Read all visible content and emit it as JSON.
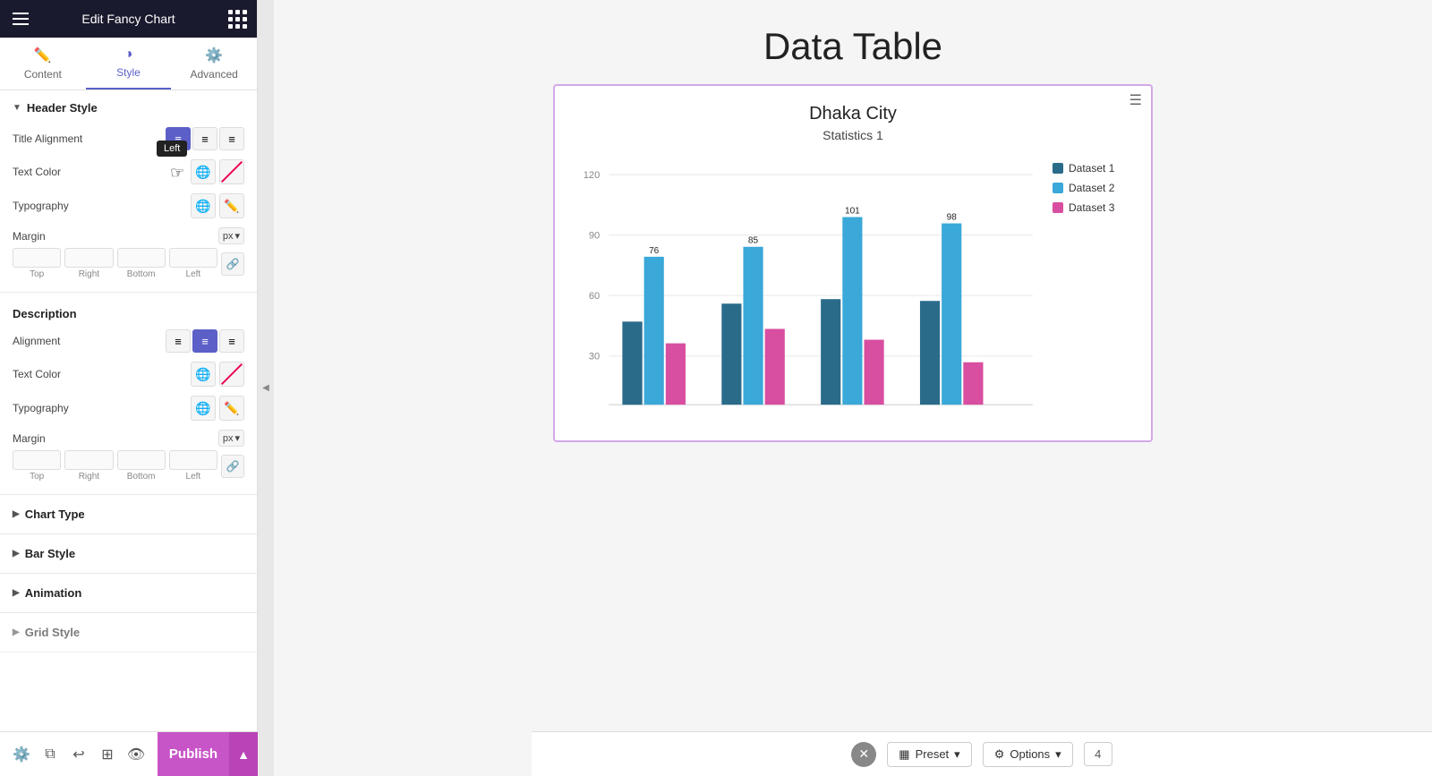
{
  "panel": {
    "title": "Edit Fancy Chart",
    "tabs": [
      {
        "id": "content",
        "label": "Content",
        "icon": "✏️"
      },
      {
        "id": "style",
        "label": "Style",
        "icon": "◑"
      },
      {
        "id": "advanced",
        "label": "Advanced",
        "icon": "⚙️"
      }
    ],
    "active_tab": "style",
    "sections": {
      "header_style": {
        "label": "Header Style",
        "title_alignment": {
          "label": "Title Alignment",
          "options": [
            "left",
            "center",
            "right"
          ],
          "active": "left"
        },
        "text_color": {
          "label": "Text Color"
        },
        "typography": {
          "label": "Typography"
        },
        "margin": {
          "label": "Margin",
          "unit": "px",
          "top": "",
          "right": "",
          "bottom": "",
          "left": "",
          "labels": [
            "Top",
            "Right",
            "Bottom",
            "Left"
          ]
        }
      },
      "description": {
        "label": "Description",
        "alignment": {
          "label": "Alignment",
          "options": [
            "left",
            "center",
            "right"
          ],
          "active": "center"
        },
        "text_color": {
          "label": "Text Color"
        },
        "typography": {
          "label": "Typography"
        },
        "margin": {
          "label": "Margin",
          "unit": "px",
          "top": "",
          "right": "",
          "bottom": "",
          "left": "",
          "labels": [
            "Top",
            "Right",
            "Bottom",
            "Left"
          ]
        }
      },
      "chart_type": {
        "label": "Chart Type"
      },
      "bar_style": {
        "label": "Bar Style"
      },
      "animation": {
        "label": "Animation"
      },
      "grid_style": {
        "label": "Grid Style"
      }
    }
  },
  "tooltip": {
    "text": "Left"
  },
  "bottom_bar": {
    "publish_label": "Publish"
  },
  "main": {
    "page_title": "Data Table",
    "chart": {
      "title": "Dhaka City",
      "subtitle": "Statistics 1",
      "legend": [
        {
          "label": "Dataset 1",
          "color": "#2a6b8a"
        },
        {
          "label": "Dataset 2",
          "color": "#3aa8d8"
        },
        {
          "label": "Dataset 3",
          "color": "#d84ea0"
        }
      ],
      "y_labels": [
        "120",
        "90",
        "60",
        "30"
      ],
      "groups": [
        {
          "bars": [
            {
              "value": 44,
              "color": "#2a6b8a",
              "height_pct": 37
            },
            {
              "value": 76,
              "color": "#3aa8d8",
              "height_pct": 63
            },
            {
              "value": 35,
              "color": "#d84ea0",
              "height_pct": 29
            }
          ]
        },
        {
          "bars": [
            {
              "value": 55,
              "color": "#2a6b8a",
              "height_pct": 46
            },
            {
              "value": 85,
              "color": "#3aa8d8",
              "height_pct": 71
            },
            {
              "value": 41,
              "color": "#d84ea0",
              "height_pct": 34
            }
          ]
        },
        {
          "bars": [
            {
              "value": 57,
              "color": "#2a6b8a",
              "height_pct": 48
            },
            {
              "value": 101,
              "color": "#3aa8d8",
              "height_pct": 84
            },
            {
              "value": 36,
              "color": "#d84ea0",
              "height_pct": 30
            }
          ]
        },
        {
          "bars": [
            {
              "value": 56,
              "color": "#2a6b8a",
              "height_pct": 47
            },
            {
              "value": 98,
              "color": "#3aa8d8",
              "height_pct": 82
            },
            {
              "value": 26,
              "color": "#d84ea0",
              "height_pct": 22
            }
          ]
        }
      ]
    }
  },
  "toolbar": {
    "preset_label": "Preset",
    "options_label": "Options",
    "page_number": "4",
    "close_icon": "✕"
  }
}
